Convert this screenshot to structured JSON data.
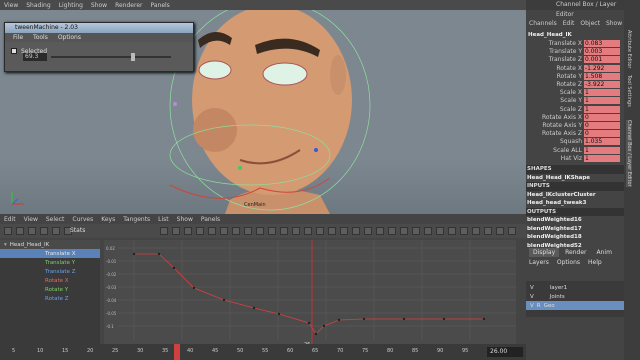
{
  "viewport_menu": [
    "View",
    "Shading",
    "Lighting",
    "Show",
    "Renderer",
    "Panels"
  ],
  "tween": {
    "title": "tweenMachine - 2.03",
    "menu": [
      "File",
      "Tools",
      "Options"
    ],
    "selected_label": "Selected",
    "value": "69.3"
  },
  "viewport": {
    "label": "CenMain"
  },
  "channel_box": {
    "title": "Channel Box / Layer Editor",
    "menu": [
      "Channels",
      "Edit",
      "Object",
      "Show"
    ],
    "node": "Head_Head_IK",
    "attrs": [
      [
        "Translate X",
        "0.083"
      ],
      [
        "Translate Y",
        "0.003"
      ],
      [
        "Translate Z",
        "0.001"
      ],
      [
        "Rotate X",
        "-1.292"
      ],
      [
        "Rotate Y",
        "1.508"
      ],
      [
        "Rotate Z",
        "-3.922"
      ],
      [
        "Scale X",
        "1"
      ],
      [
        "Scale Y",
        "1"
      ],
      [
        "Scale Z",
        "1"
      ],
      [
        "Rotate Axis X",
        "0"
      ],
      [
        "Rotate Axis Y",
        "0"
      ],
      [
        "Rotate Axis Z",
        "0"
      ],
      [
        "Squash",
        "1.035"
      ],
      [
        "Scale ALL",
        "1"
      ],
      [
        "Hat Viz",
        "1"
      ]
    ],
    "shapes_label": "SHAPES",
    "shape": "Head_Head_IKShape",
    "inputs_label": "INPUTS",
    "inputs": [
      "Head_IKclusterCluster",
      "Head_head_tweak3"
    ],
    "outputs_label": "OUTPUTS",
    "outputs": [
      "blendWeighted16",
      "blendWeighted17",
      "blendWeighted18",
      "blendWeighted52"
    ]
  },
  "side_tabs": [
    "Attribute Editor",
    "Tool Settings",
    "Channel Box / Layer Editor"
  ],
  "graph_editor": {
    "menu": [
      "Edit",
      "View",
      "Select",
      "Curves",
      "Keys",
      "Tangents",
      "List",
      "Show",
      "Panels"
    ],
    "stats_label": "Stats",
    "outliner": {
      "node": "Head_Head_IK",
      "channels": [
        {
          "label": "Translate X",
          "color": "#e8e8e8"
        },
        {
          "label": "Translate Y",
          "color": "#7fd06a"
        },
        {
          "label": "Translate Z",
          "color": "#6aa0e8"
        },
        {
          "label": "Rotate X",
          "color": "#e86a6a"
        },
        {
          "label": "Rotate Y",
          "color": "#7fd06a"
        },
        {
          "label": "Rotate Z",
          "color": "#6aa0e8"
        }
      ]
    },
    "y_ticks": [
      "0.02",
      "-0.01",
      "-0.02",
      "-0.03",
      "-0.04",
      "-0.05",
      "-0.1"
    ],
    "x_ticks": [
      "8",
      "16",
      "24",
      "32",
      "40",
      "48",
      "56",
      "64"
    ],
    "current_frame": "26"
  },
  "layer_editor": {
    "tabs": [
      "Display",
      "Render",
      "Anim"
    ],
    "menu": [
      "Layers",
      "Options",
      "Help"
    ],
    "layers": [
      {
        "v": "V",
        "name": "layer1"
      },
      {
        "v": "V",
        "name": "Joints"
      },
      {
        "v": "V",
        "r": "R",
        "name": "Geo"
      }
    ]
  },
  "timeline": {
    "frame_box": "26.00",
    "ticks": [
      "5",
      "10",
      "15",
      "20",
      "25",
      "30",
      "35",
      "40",
      "45",
      "50",
      "55",
      "60",
      "65",
      "70",
      "75",
      "80",
      "85",
      "90",
      "95"
    ]
  }
}
